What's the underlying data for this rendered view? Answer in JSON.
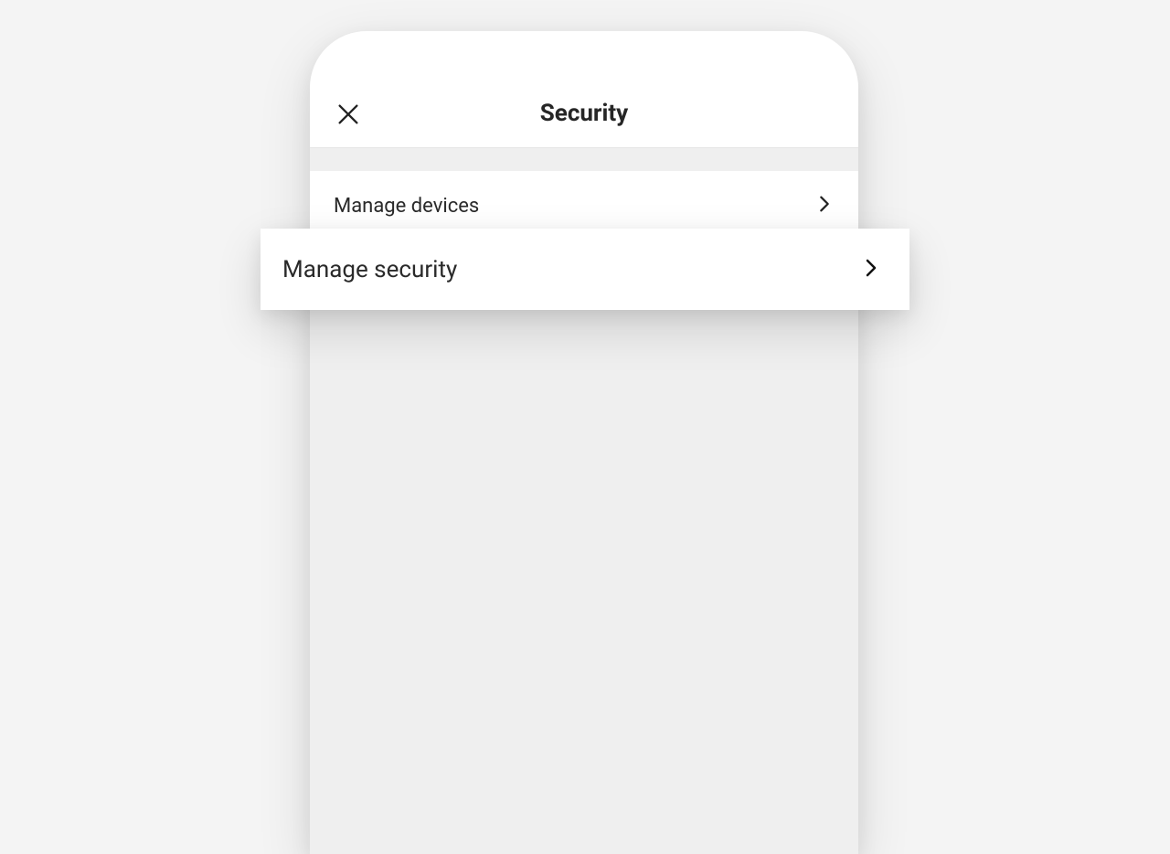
{
  "header": {
    "title": "Security"
  },
  "items": [
    {
      "label": "Manage devices"
    }
  ],
  "popout": {
    "label": "Manage security"
  }
}
